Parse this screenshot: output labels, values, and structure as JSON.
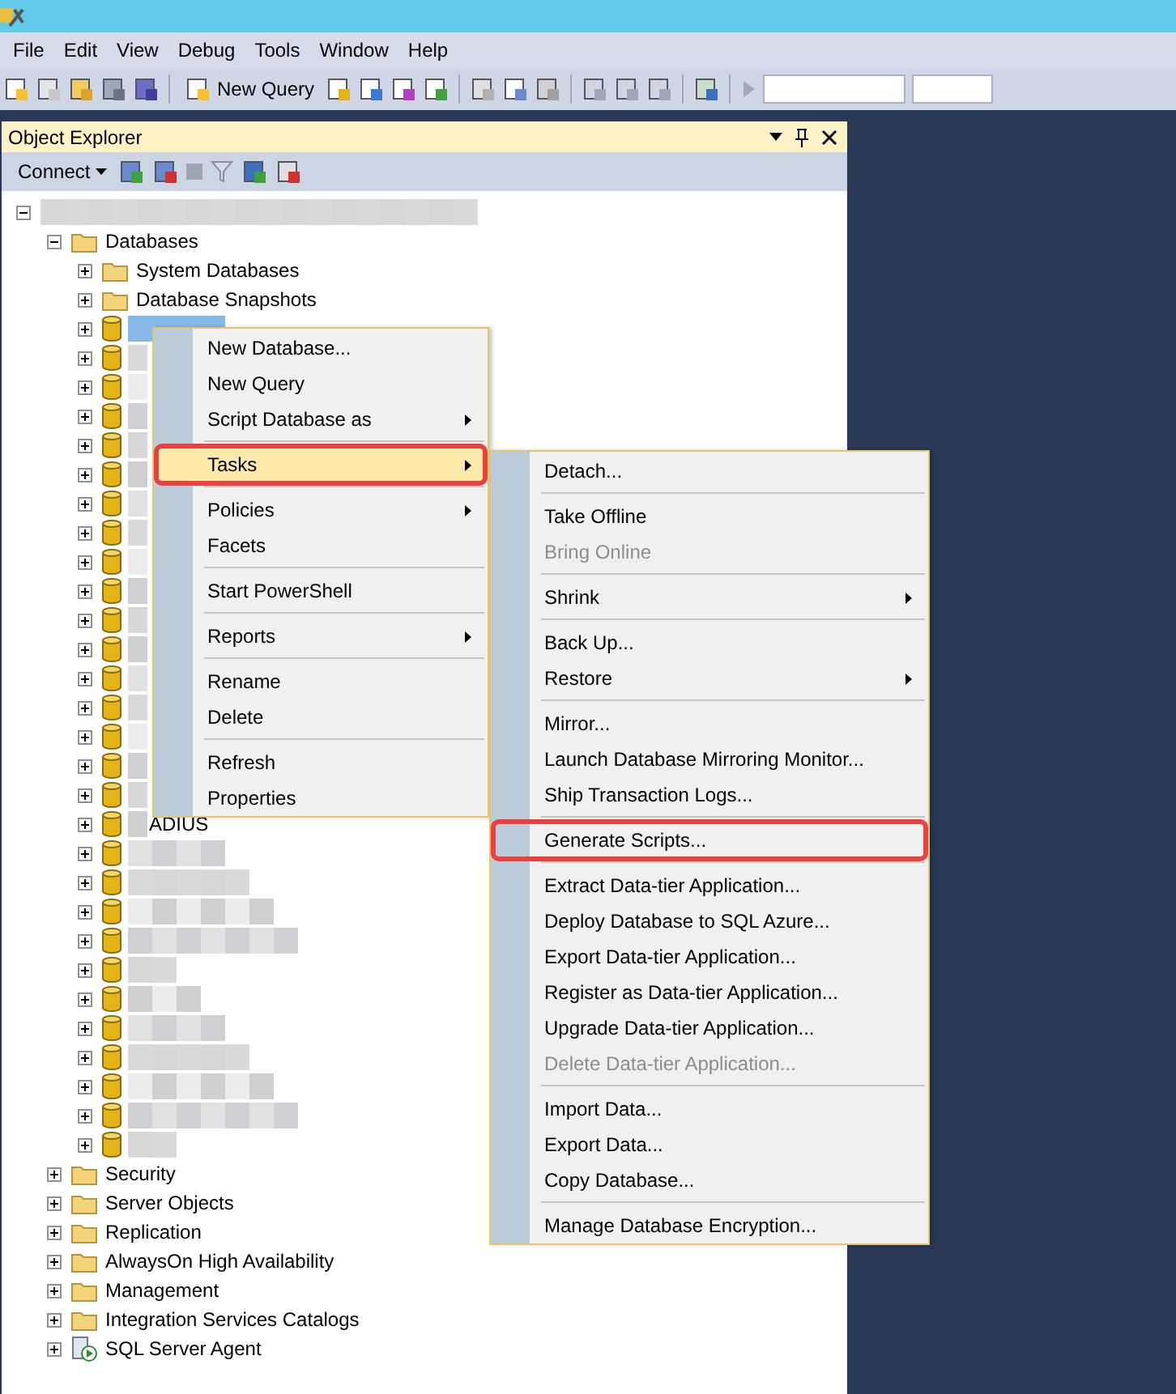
{
  "menu_bar": [
    "File",
    "Edit",
    "View",
    "Debug",
    "Tools",
    "Window",
    "Help"
  ],
  "toolbar": {
    "new_query": "New Query"
  },
  "object_explorer": {
    "title": "Object Explorer",
    "connect": "Connect",
    "tree": [
      {
        "kind": "server",
        "expanded": true,
        "children": [
          {
            "kind": "folder",
            "label": "Databases",
            "expanded": true,
            "children": [
              {
                "kind": "folder",
                "label": "System Databases",
                "expanded": false
              },
              {
                "kind": "folder",
                "label": "Database Snapshots",
                "expanded": false
              },
              {
                "kind": "database",
                "selected": true,
                "expanded": false
              },
              {
                "kind": "database",
                "selected": false,
                "expanded": false
              },
              {
                "kind": "database",
                "selected": false,
                "expanded": false
              },
              {
                "kind": "database",
                "selected": false,
                "expanded": false
              },
              {
                "kind": "database",
                "selected": false,
                "expanded": false
              },
              {
                "kind": "database",
                "selected": false,
                "expanded": false
              },
              {
                "kind": "database",
                "selected": false,
                "expanded": false
              },
              {
                "kind": "database",
                "selected": false,
                "expanded": false
              },
              {
                "kind": "database",
                "selected": false,
                "expanded": false
              },
              {
                "kind": "database",
                "selected": false,
                "expanded": false
              },
              {
                "kind": "database",
                "selected": false,
                "expanded": false
              },
              {
                "kind": "database",
                "selected": false,
                "expanded": false
              },
              {
                "kind": "database",
                "selected": false,
                "expanded": false
              },
              {
                "kind": "database",
                "selected": false,
                "expanded": false
              },
              {
                "kind": "database",
                "selected": false,
                "expanded": false
              },
              {
                "kind": "database",
                "selected": false,
                "expanded": false
              },
              {
                "kind": "database",
                "selected": false,
                "expanded": false
              },
              {
                "kind": "database",
                "selected": false,
                "expanded": false,
                "label": "ADIUS"
              },
              {
                "kind": "database",
                "selected": false,
                "expanded": false
              },
              {
                "kind": "database",
                "selected": false,
                "expanded": false
              },
              {
                "kind": "database",
                "selected": false,
                "expanded": false
              },
              {
                "kind": "database",
                "selected": false,
                "expanded": false
              },
              {
                "kind": "database",
                "selected": false,
                "expanded": false
              },
              {
                "kind": "database",
                "selected": false,
                "expanded": false
              },
              {
                "kind": "database",
                "selected": false,
                "expanded": false
              },
              {
                "kind": "database",
                "selected": false,
                "expanded": false
              },
              {
                "kind": "database",
                "selected": false,
                "expanded": false
              },
              {
                "kind": "database",
                "selected": false,
                "expanded": false
              },
              {
                "kind": "database",
                "selected": false,
                "expanded": false
              }
            ]
          },
          {
            "kind": "folder",
            "label": "Security",
            "expanded": false
          },
          {
            "kind": "folder",
            "label": "Server Objects",
            "expanded": false
          },
          {
            "kind": "folder",
            "label": "Replication",
            "expanded": false
          },
          {
            "kind": "folder",
            "label": "AlwaysOn High Availability",
            "expanded": false
          },
          {
            "kind": "folder",
            "label": "Management",
            "expanded": false
          },
          {
            "kind": "folder",
            "label": "Integration Services Catalogs",
            "expanded": false
          },
          {
            "kind": "agent",
            "label": "SQL Server Agent",
            "expanded": false
          }
        ]
      }
    ]
  },
  "context_menu": [
    {
      "kind": "item",
      "label": "New Database...",
      "submenu": false,
      "selected": false,
      "outlined": false
    },
    {
      "kind": "item",
      "label": "New Query",
      "submenu": false,
      "selected": false,
      "outlined": false
    },
    {
      "kind": "item",
      "label": "Script Database as",
      "submenu": true,
      "selected": false,
      "outlined": false
    },
    {
      "kind": "separator"
    },
    {
      "kind": "item",
      "label": "Tasks",
      "submenu": true,
      "selected": true,
      "outlined": true
    },
    {
      "kind": "separator"
    },
    {
      "kind": "item",
      "label": "Policies",
      "submenu": true,
      "selected": false,
      "outlined": false
    },
    {
      "kind": "item",
      "label": "Facets",
      "submenu": false,
      "selected": false,
      "outlined": false
    },
    {
      "kind": "separator"
    },
    {
      "kind": "item",
      "label": "Start PowerShell",
      "submenu": false,
      "selected": false,
      "outlined": false
    },
    {
      "kind": "separator"
    },
    {
      "kind": "item",
      "label": "Reports",
      "submenu": true,
      "selected": false,
      "outlined": false
    },
    {
      "kind": "separator"
    },
    {
      "kind": "item",
      "label": "Rename",
      "submenu": false,
      "selected": false,
      "outlined": false
    },
    {
      "kind": "item",
      "label": "Delete",
      "submenu": false,
      "selected": false,
      "outlined": false
    },
    {
      "kind": "separator"
    },
    {
      "kind": "item",
      "label": "Refresh",
      "submenu": false,
      "selected": false,
      "outlined": false
    },
    {
      "kind": "item",
      "label": "Properties",
      "submenu": false,
      "selected": false,
      "outlined": false
    }
  ],
  "tasks_submenu": [
    {
      "kind": "item",
      "label": "Detach...",
      "submenu": false,
      "disabled": false,
      "outlined": false
    },
    {
      "kind": "separator"
    },
    {
      "kind": "item",
      "label": "Take Offline",
      "submenu": false,
      "disabled": false,
      "outlined": false
    },
    {
      "kind": "item",
      "label": "Bring Online",
      "submenu": false,
      "disabled": true,
      "outlined": false
    },
    {
      "kind": "separator"
    },
    {
      "kind": "item",
      "label": "Shrink",
      "submenu": true,
      "disabled": false,
      "outlined": false
    },
    {
      "kind": "separator"
    },
    {
      "kind": "item",
      "label": "Back Up...",
      "submenu": false,
      "disabled": false,
      "outlined": false
    },
    {
      "kind": "item",
      "label": "Restore",
      "submenu": true,
      "disabled": false,
      "outlined": false
    },
    {
      "kind": "separator"
    },
    {
      "kind": "item",
      "label": "Mirror...",
      "submenu": false,
      "disabled": false,
      "outlined": false
    },
    {
      "kind": "item",
      "label": "Launch Database Mirroring Monitor...",
      "submenu": false,
      "disabled": false,
      "outlined": false
    },
    {
      "kind": "item",
      "label": "Ship Transaction Logs...",
      "submenu": false,
      "disabled": false,
      "outlined": false
    },
    {
      "kind": "separator"
    },
    {
      "kind": "item",
      "label": "Generate Scripts...",
      "submenu": false,
      "disabled": false,
      "outlined": true
    },
    {
      "kind": "separator"
    },
    {
      "kind": "item",
      "label": "Extract Data-tier Application...",
      "submenu": false,
      "disabled": false,
      "outlined": false
    },
    {
      "kind": "item",
      "label": "Deploy Database to SQL Azure...",
      "submenu": false,
      "disabled": false,
      "outlined": false
    },
    {
      "kind": "item",
      "label": "Export Data-tier Application...",
      "submenu": false,
      "disabled": false,
      "outlined": false
    },
    {
      "kind": "item",
      "label": "Register as Data-tier Application...",
      "submenu": false,
      "disabled": false,
      "outlined": false
    },
    {
      "kind": "item",
      "label": "Upgrade Data-tier Application...",
      "submenu": false,
      "disabled": false,
      "outlined": false
    },
    {
      "kind": "item",
      "label": "Delete Data-tier Application...",
      "submenu": false,
      "disabled": true,
      "outlined": false
    },
    {
      "kind": "separator"
    },
    {
      "kind": "item",
      "label": "Import Data...",
      "submenu": false,
      "disabled": false,
      "outlined": false
    },
    {
      "kind": "item",
      "label": "Export Data...",
      "submenu": false,
      "disabled": false,
      "outlined": false
    },
    {
      "kind": "item",
      "label": "Copy Database...",
      "submenu": false,
      "disabled": false,
      "outlined": false
    },
    {
      "kind": "separator"
    },
    {
      "kind": "item",
      "label": "Manage Database Encryption...",
      "submenu": false,
      "disabled": false,
      "outlined": false
    }
  ]
}
